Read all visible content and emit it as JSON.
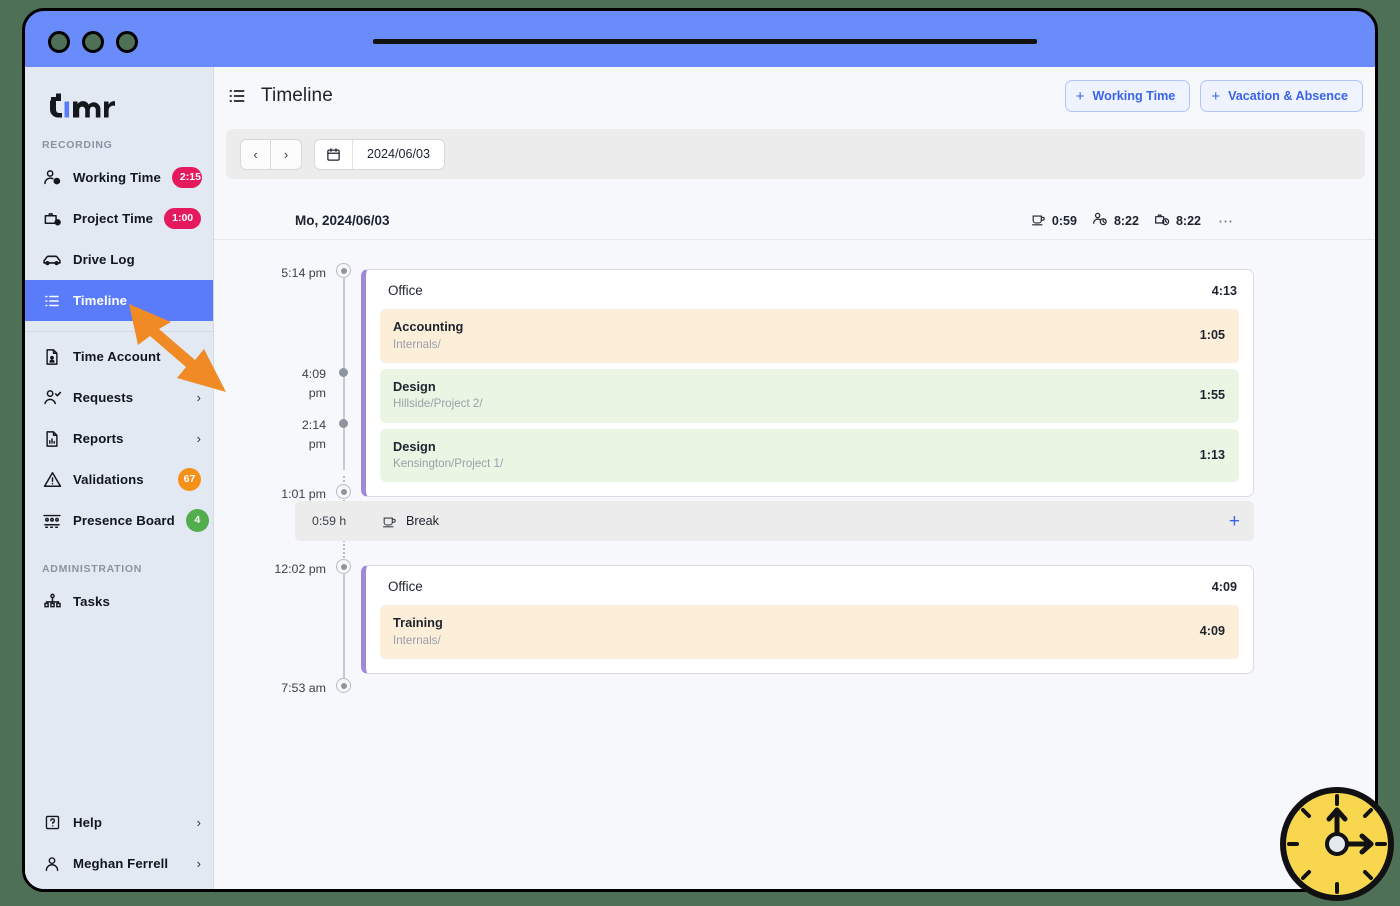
{
  "window": {
    "traffic_lights": [
      "close",
      "minimize",
      "maximize"
    ]
  },
  "sidebar": {
    "logo": "timr",
    "sections": [
      {
        "label": "RECORDING",
        "items": [
          {
            "name": "working-time",
            "label": "Working Time",
            "icon": "person-clock-icon",
            "badge": "2:15",
            "badge_style": "pink"
          },
          {
            "name": "project-time",
            "label": "Project Time",
            "icon": "briefcase-clock-icon",
            "badge": "1:00",
            "badge_style": "pink"
          },
          {
            "name": "drive-log",
            "label": "Drive Log",
            "icon": "car-icon"
          },
          {
            "name": "timeline",
            "label": "Timeline",
            "icon": "list-icon",
            "active": true
          }
        ]
      },
      {
        "label": "",
        "items": [
          {
            "name": "time-account",
            "label": "Time Account",
            "icon": "document-person-icon"
          },
          {
            "name": "requests",
            "label": "Requests",
            "icon": "person-check-icon",
            "chevron": "›"
          },
          {
            "name": "reports",
            "label": "Reports",
            "icon": "document-chart-icon",
            "chevron": "›"
          },
          {
            "name": "validations",
            "label": "Validations",
            "icon": "warning-triangle-icon",
            "badge": "67",
            "badge_style": "orange"
          },
          {
            "name": "presence-board",
            "label": "Presence Board",
            "icon": "presence-board-icon",
            "badge": "4",
            "badge_style": "green"
          }
        ]
      },
      {
        "label": "ADMINISTRATION",
        "items": [
          {
            "name": "tasks",
            "label": "Tasks",
            "icon": "hierarchy-icon"
          }
        ]
      }
    ],
    "bottom_items": [
      {
        "name": "help",
        "label": "Help",
        "icon": "question-box-icon",
        "chevron": "›"
      },
      {
        "name": "user",
        "label": "Meghan Ferrell",
        "icon": "person-icon",
        "chevron": "›"
      }
    ]
  },
  "header": {
    "icon": "list-icon",
    "title": "Timeline",
    "actions": [
      {
        "name": "add-working-time",
        "label": "Working Time",
        "plus": "+"
      },
      {
        "name": "add-vacation-absence",
        "label": "Vacation & Absence",
        "plus": "+"
      }
    ]
  },
  "toolbar": {
    "prev": "‹",
    "next": "›",
    "calendar_icon": "calendar-icon",
    "date": "2024/06/03"
  },
  "day": {
    "title": "Mo, 2024/06/03",
    "stats": [
      {
        "name": "break-total",
        "icon": "coffee-icon",
        "value": "0:59"
      },
      {
        "name": "working-time-total",
        "icon": "person-clock-icon",
        "value": "8:22"
      },
      {
        "name": "project-time-total",
        "icon": "briefcase-clock-icon",
        "value": "8:22"
      }
    ],
    "more": "⋯"
  },
  "timeline": {
    "markers": [
      {
        "time": "5:14 pm",
        "type": "ring"
      },
      {
        "time": "4:09\npm",
        "type": "solid"
      },
      {
        "time": "2:14\npm",
        "type": "solid"
      },
      {
        "time": "1:01 pm",
        "type": "ring"
      },
      {
        "time": "12:02 pm",
        "type": "ring"
      },
      {
        "time": "7:53 am",
        "type": "ring"
      }
    ],
    "marker_times": {
      "t0": "5:14 pm",
      "t1_a": "4:09",
      "t1_b": "pm",
      "t2_a": "2:14",
      "t2_b": "pm",
      "t3": "1:01 pm",
      "t4": "12:02 pm",
      "t5": "7:53 am"
    },
    "cards": [
      {
        "name": "working-time-card-afternoon",
        "title": "Office",
        "duration": "4:13",
        "entries": [
          {
            "title": "Accounting",
            "subtitle": "Internals/",
            "duration": "1:05",
            "color": "orange"
          },
          {
            "title": "Design",
            "subtitle": "Hillside/Project 2/",
            "duration": "1:55",
            "color": "green"
          },
          {
            "title": "Design",
            "subtitle": "Kensington/Project 1/",
            "duration": "1:13",
            "color": "green"
          }
        ]
      },
      {
        "name": "working-time-card-morning",
        "title": "Office",
        "duration": "4:09",
        "entries": [
          {
            "title": "Training",
            "subtitle": "Internals/",
            "duration": "4:09",
            "color": "orange"
          }
        ]
      }
    ],
    "break": {
      "name": "break-row",
      "duration": "0:59 h",
      "icon": "coffee-icon",
      "label": "Break",
      "add": "+"
    }
  },
  "annotations": {
    "arrow": {
      "name": "pointer-arrow",
      "color": "#f08a24",
      "points_at": "sidebar-item-timeline"
    },
    "badge": {
      "name": "clock-badge",
      "color": "#f8d74f"
    }
  }
}
